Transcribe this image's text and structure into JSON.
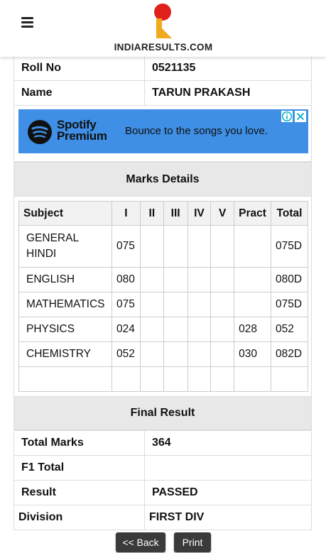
{
  "header": {
    "logo_text": "INDIARESULTS.COM",
    "menu_icon": "hamburger-menu-icon"
  },
  "student": {
    "roll_label": "Roll No",
    "roll_value": "0521135",
    "name_label": "Name",
    "name_value": "TARUN PRAKASH"
  },
  "ad": {
    "brand_line1": "Spotify",
    "brand_line2": "Premium",
    "tagline": "Bounce to the songs you love.",
    "bg_color": "#3e8fe5",
    "info_icon": "info-icon",
    "close_icon": "close-icon"
  },
  "marks": {
    "title": "Marks Details",
    "headers": [
      "Subject",
      "I",
      "II",
      "III",
      "IV",
      "V",
      "Pract",
      "Total"
    ],
    "rows": [
      {
        "subject": "GENERAL HINDI",
        "i": "075",
        "ii": "",
        "iii": "",
        "iv": "",
        "v": "",
        "pract": "",
        "total": "075D"
      },
      {
        "subject": "ENGLISH",
        "i": "080",
        "ii": "",
        "iii": "",
        "iv": "",
        "v": "",
        "pract": "",
        "total": "080D"
      },
      {
        "subject": "MATHEMATICS",
        "i": "075",
        "ii": "",
        "iii": "",
        "iv": "",
        "v": "",
        "pract": "",
        "total": "075D"
      },
      {
        "subject": "PHYSICS",
        "i": "024",
        "ii": "",
        "iii": "",
        "iv": "",
        "v": "",
        "pract": "028",
        "total": "052"
      },
      {
        "subject": "CHEMISTRY",
        "i": "052",
        "ii": "",
        "iii": "",
        "iv": "",
        "v": "",
        "pract": "030",
        "total": "082D"
      },
      {
        "subject": "",
        "i": "",
        "ii": "",
        "iii": "",
        "iv": "",
        "v": "",
        "pract": "",
        "total": ""
      }
    ]
  },
  "final": {
    "title": "Final Result",
    "total_marks_label": "Total Marks",
    "total_marks_value": "364",
    "f1_total_label": "F1 Total",
    "f1_total_value": "",
    "result_label": "Result",
    "result_value": "PASSED",
    "division_label": "Division",
    "division_value": "FIRST DIV"
  },
  "buttons": {
    "back": "<< Back",
    "print": "Print"
  }
}
